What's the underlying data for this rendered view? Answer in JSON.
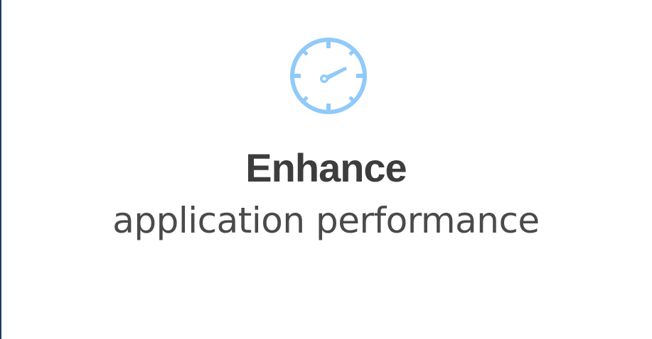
{
  "feature": {
    "icon": "speedometer-icon",
    "title": "Enhance",
    "subtitle": "application performance"
  },
  "colors": {
    "icon": "#90caf9",
    "text": "#3d3d3d",
    "left_border": "#1f3b63",
    "background": "#ffffff"
  }
}
